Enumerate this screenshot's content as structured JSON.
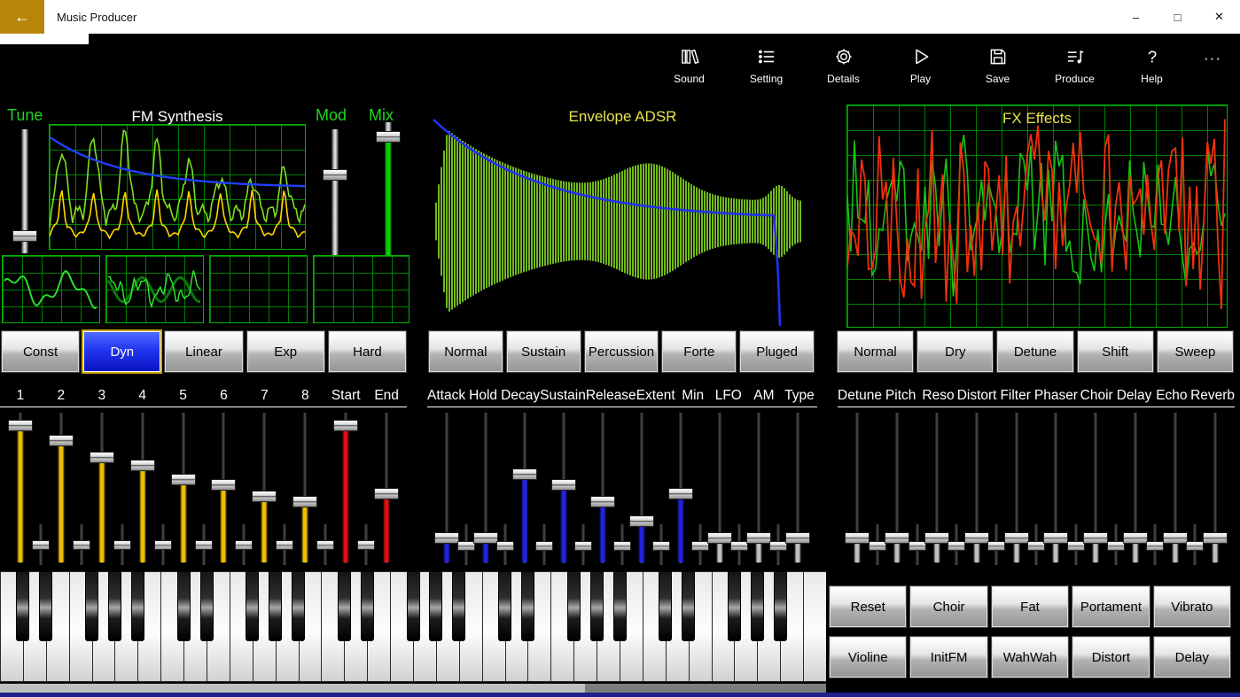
{
  "window": {
    "title": "Music Producer",
    "back_glyph": "←",
    "minimize_glyph": "–",
    "maximize_glyph": "□",
    "close_glyph": "✕"
  },
  "toolbar": {
    "items": [
      {
        "id": "sound",
        "label": "Sound"
      },
      {
        "id": "setting",
        "label": "Setting"
      },
      {
        "id": "details",
        "label": "Details"
      },
      {
        "id": "play",
        "label": "Play"
      },
      {
        "id": "save",
        "label": "Save"
      },
      {
        "id": "produce",
        "label": "Produce"
      },
      {
        "id": "help",
        "label": "Help"
      }
    ],
    "more_glyph": "···"
  },
  "fm_panel": {
    "title": "FM Synthesis",
    "tune_label": "Tune",
    "mod_label": "Mod",
    "mix_label": "Mix",
    "tune_value": 0.1,
    "mod_value": 0.66,
    "mix_value": 0.93,
    "mix_color": "#00cf00",
    "mode_buttons": [
      {
        "label": "Const",
        "selected": false
      },
      {
        "label": "Dyn",
        "selected": true
      },
      {
        "label": "Linear",
        "selected": false
      },
      {
        "label": "Exp",
        "selected": false
      },
      {
        "label": "Hard",
        "selected": false
      }
    ],
    "slider_labels": [
      "1",
      "2",
      "3",
      "4",
      "5",
      "6",
      "7",
      "8",
      "Start",
      "End"
    ],
    "sliders": [
      {
        "value": 0.95,
        "color": "#edc000"
      },
      {
        "value": 0.84,
        "color": "#edc000"
      },
      {
        "value": 0.72,
        "color": "#edc000"
      },
      {
        "value": 0.66,
        "color": "#edc000"
      },
      {
        "value": 0.56,
        "color": "#edc000"
      },
      {
        "value": 0.52,
        "color": "#edc000"
      },
      {
        "value": 0.44,
        "color": "#edc000"
      },
      {
        "value": 0.4,
        "color": "#edc000"
      },
      {
        "value": 0.95,
        "color": "#e01010"
      },
      {
        "value": 0.46,
        "color": "#e01010"
      }
    ],
    "sub_slider_value": 0.45
  },
  "adsr_panel": {
    "title": "Envelope ADSR",
    "env_buttons": [
      "Normal",
      "Sustain",
      "Percussion",
      "Forte",
      "Pluged"
    ],
    "slider_labels": [
      "Attack",
      "Hold",
      "Decay",
      "Sustain",
      "Release",
      "Extent",
      "Min",
      "LFO",
      "AM",
      "Type"
    ],
    "sliders": [
      {
        "value": 0.14,
        "color": "#2222e0"
      },
      {
        "value": 0.14,
        "color": "#2222e0"
      },
      {
        "value": 0.6,
        "color": "#2222e0"
      },
      {
        "value": 0.52,
        "color": "#2222e0"
      },
      {
        "value": 0.4,
        "color": "#2222e0"
      },
      {
        "value": 0.26,
        "color": "#2222e0"
      },
      {
        "value": 0.46,
        "color": "#2222e0"
      },
      {
        "value": 0.14,
        "color": "#c0c0c0"
      },
      {
        "value": 0.14,
        "color": "#c0c0c0"
      },
      {
        "value": 0.14,
        "color": "#c0c0c0"
      }
    ],
    "sub_slider_value": 0.42
  },
  "fx_panel": {
    "title": "FX Effects",
    "fx_buttons": [
      "Normal",
      "Dry",
      "Detune",
      "Shift",
      "Sweep"
    ],
    "slider_labels": [
      "Detune",
      "Pitch",
      "Reso",
      "Distort",
      "Filter",
      "Phaser",
      "Choir",
      "Delay",
      "Echo",
      "Reverb"
    ],
    "sliders": [
      {
        "value": 0.14,
        "color": "#c0c0c0"
      },
      {
        "value": 0.14,
        "color": "#c0c0c0"
      },
      {
        "value": 0.14,
        "color": "#c0c0c0"
      },
      {
        "value": 0.14,
        "color": "#c0c0c0"
      },
      {
        "value": 0.14,
        "color": "#c0c0c0"
      },
      {
        "value": 0.14,
        "color": "#c0c0c0"
      },
      {
        "value": 0.14,
        "color": "#c0c0c0"
      },
      {
        "value": 0.14,
        "color": "#c0c0c0"
      },
      {
        "value": 0.14,
        "color": "#c0c0c0"
      },
      {
        "value": 0.14,
        "color": "#c0c0c0"
      }
    ],
    "sub_slider_value": 0.42,
    "preset_buttons_row1": [
      "Reset",
      "Choir",
      "Fat",
      "Portament",
      "Vibrato"
    ],
    "preset_buttons_row2": [
      "Violine",
      "InitFM",
      "WahWah",
      "Distort",
      "Delay"
    ]
  },
  "piano": {
    "white_key_count": 36,
    "black_after_notes": [
      0,
      1,
      3,
      4,
      5
    ]
  },
  "colors": {
    "accent_selected": "#2136f0",
    "grid_green": "#00b400",
    "label_green": "#1ed61e",
    "title_yellow": "#e8e44c",
    "back_button_gold": "#b8860b"
  }
}
